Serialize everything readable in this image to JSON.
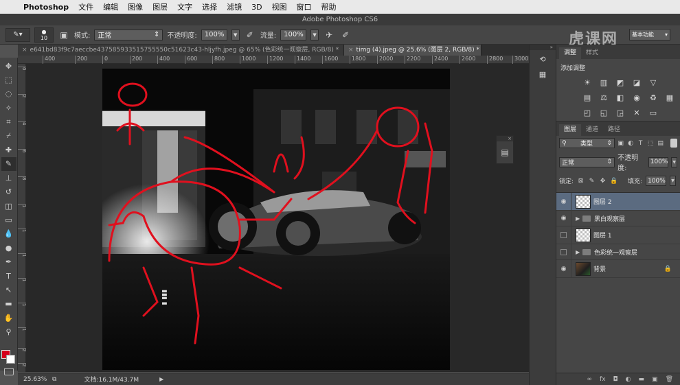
{
  "menubar": {
    "app_name": "Photoshop",
    "items": [
      "文件",
      "编辑",
      "图像",
      "图层",
      "文字",
      "选择",
      "滤镜",
      "3D",
      "视图",
      "窗口",
      "帮助"
    ]
  },
  "window": {
    "title": "Adobe Photoshop CS6"
  },
  "options_bar": {
    "brush_size": "10",
    "mode_label": "模式:",
    "mode_value": "正常",
    "opacity_label": "不透明度:",
    "opacity_value": "100%",
    "flow_label": "流量:",
    "flow_value": "100%",
    "workspace_value": "基本功能",
    "watermark": "虎课网"
  },
  "doc_tabs": [
    {
      "label": "e641bd83f9c7aeccbe437585933515755550c51623c43-hljyfh.jpeg @ 65% (色彩统一观察层, RGB/8) *",
      "active": false
    },
    {
      "label": "timg (4).jpeg @ 25.6% (图层 2, RGB/8) *",
      "active": true
    }
  ],
  "ruler_h": [
    "400",
    "200",
    "0",
    "200",
    "400",
    "600",
    "800",
    "1000",
    "1200",
    "1400",
    "1600",
    "1800",
    "2000",
    "2200",
    "2400",
    "2600",
    "2800",
    "3000"
  ],
  "ruler_v": [
    "0",
    "2",
    "4",
    "6",
    "8",
    "1",
    "1",
    "1",
    "1",
    "1",
    "1",
    "2",
    "2"
  ],
  "status_bar": {
    "zoom": "25.63%",
    "doc_info": "文档:16.1M/43.7M"
  },
  "adjustments_panel": {
    "tabs": [
      "调整",
      "样式"
    ],
    "title": "添加调整"
  },
  "layers_panel": {
    "tabs": [
      "图层",
      "通道",
      "路径"
    ],
    "filter_value": "类型",
    "blend_mode": "正常",
    "opacity_label": "不透明度:",
    "opacity_value": "100%",
    "lock_label": "锁定:",
    "fill_label": "填充:",
    "fill_value": "100%",
    "layers": [
      {
        "name": "图层 2",
        "visible": true,
        "type": "layer",
        "selected": true
      },
      {
        "name": "黑白观察层",
        "visible": true,
        "type": "group",
        "selected": false
      },
      {
        "name": "图层 1",
        "visible": false,
        "type": "layer",
        "selected": false
      },
      {
        "name": "色彩统一观察层",
        "visible": false,
        "type": "group",
        "selected": false
      },
      {
        "name": "背景",
        "visible": true,
        "type": "background",
        "selected": false,
        "locked": true
      }
    ]
  },
  "colors": {
    "foreground": "#d6001c",
    "background": "#ffffff",
    "annotation_red": "#e0101e"
  }
}
